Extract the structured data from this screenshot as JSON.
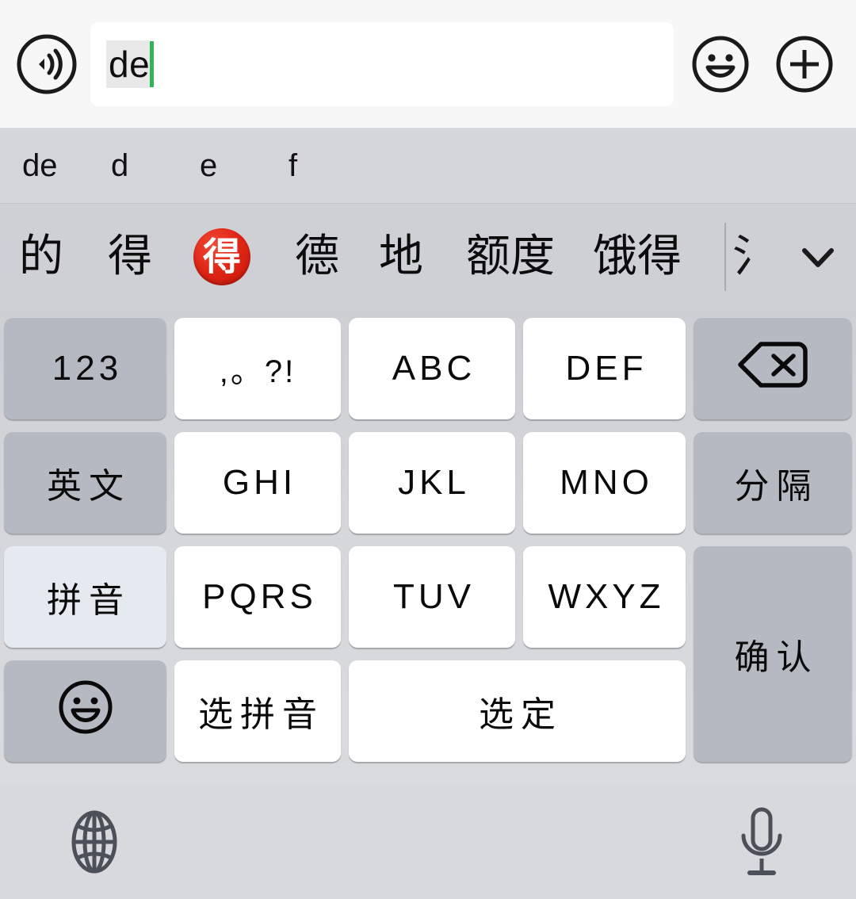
{
  "input_bar": {
    "voice_icon": "voice-wave-icon",
    "composing_text": "de",
    "emoji_icon": "smiley-face-icon",
    "add_icon": "plus-circle-icon"
  },
  "pinyin_row": {
    "segments": [
      "de",
      "d",
      "e",
      "f"
    ]
  },
  "candidate_row": {
    "candidates": [
      {
        "text": "的",
        "type": "text"
      },
      {
        "text": "得",
        "type": "text"
      },
      {
        "text": "得",
        "type": "emoji-badge"
      },
      {
        "text": "德",
        "type": "text"
      },
      {
        "text": "地",
        "type": "text"
      },
      {
        "text": "额度",
        "type": "text"
      },
      {
        "text": "饿得",
        "type": "text"
      },
      {
        "text": "氵",
        "type": "clipped"
      }
    ],
    "expand_icon": "chevron-down-icon"
  },
  "keyboard": {
    "rows": [
      [
        {
          "label": "123",
          "style": "dark",
          "name": "key-123",
          "kind": "lat"
        },
        {
          "label": ",。?!",
          "style": "light",
          "name": "key-punctuation",
          "kind": "punct"
        },
        {
          "label": "ABC",
          "style": "light",
          "name": "key-abc",
          "kind": "lat"
        },
        {
          "label": "DEF",
          "style": "light",
          "name": "key-def",
          "kind": "lat"
        },
        {
          "label": "",
          "style": "dark",
          "name": "key-backspace",
          "kind": "icon",
          "icon": "backspace-icon"
        }
      ],
      [
        {
          "label": "英文",
          "style": "dark",
          "name": "key-english-mode",
          "kind": "cn"
        },
        {
          "label": "GHI",
          "style": "light",
          "name": "key-ghi",
          "kind": "lat"
        },
        {
          "label": "JKL",
          "style": "light",
          "name": "key-jkl",
          "kind": "lat"
        },
        {
          "label": "MNO",
          "style": "light",
          "name": "key-mno",
          "kind": "lat"
        },
        {
          "label": "分隔",
          "style": "dark",
          "name": "key-separator",
          "kind": "cn"
        }
      ],
      [
        {
          "label": "拼音",
          "style": "active",
          "name": "key-pinyin-mode",
          "kind": "cn"
        },
        {
          "label": "PQRS",
          "style": "light",
          "name": "key-pqrs",
          "kind": "lat"
        },
        {
          "label": "TUV",
          "style": "light",
          "name": "key-tuv",
          "kind": "lat"
        },
        {
          "label": "WXYZ",
          "style": "light",
          "name": "key-wxyz",
          "kind": "lat"
        },
        {
          "label": "确认",
          "style": "dark",
          "name": "key-confirm",
          "kind": "cn",
          "span_rows": 2
        }
      ],
      [
        {
          "label": "",
          "style": "dark",
          "name": "key-emoji",
          "kind": "icon",
          "icon": "smiley-face-icon"
        },
        {
          "label": "选拼音",
          "style": "light",
          "name": "key-choose-pinyin",
          "kind": "cn"
        },
        {
          "label": "选定",
          "style": "light",
          "name": "key-select",
          "kind": "cn",
          "span_cols": 2
        }
      ]
    ]
  },
  "bottom_bar": {
    "globe_icon": "globe-icon",
    "mic_icon": "microphone-icon"
  },
  "colors": {
    "accent_caret": "#2fb457",
    "emoji_badge_red": "#e02717",
    "key_light": "#ffffff",
    "key_dark": "#b5b9c1",
    "key_active": "#e5e9f0",
    "keyboard_bg": "#d4d6da"
  }
}
